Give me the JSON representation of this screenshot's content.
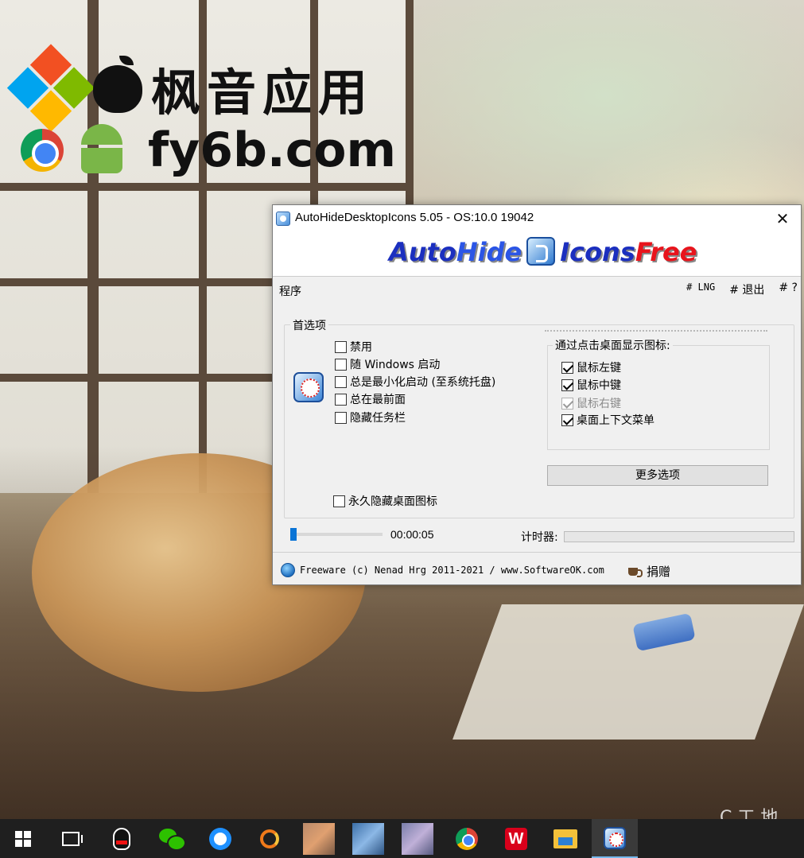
{
  "watermark": {
    "title": "枫音应用",
    "url": "fy6b.com"
  },
  "window": {
    "title": "AutoHideDesktopIcons 5.05 - OS:10.0 19042",
    "close": "✕"
  },
  "banner": {
    "auto": "Auto",
    "hide": "Hide",
    "icons": "Icons",
    "free": "Free"
  },
  "menu": {
    "program": "程序",
    "lng": "# LNG",
    "exit": "# 退出",
    "help": "# ?"
  },
  "preferences": {
    "label": "首选项",
    "options": [
      {
        "label": "禁用",
        "checked": false
      },
      {
        "label": "随 Windows 启动",
        "checked": false
      },
      {
        "label": "总是最小化启动 (至系统托盘)",
        "checked": false
      },
      {
        "label": "总在最前面",
        "checked": false
      },
      {
        "label": "隐藏任务栏",
        "checked": false
      }
    ],
    "permanent_hide": {
      "label": "永久隐藏桌面图标",
      "checked": false
    }
  },
  "show_icons": {
    "label": "通过点击桌面显示图标:",
    "options": [
      {
        "label": "鼠标左键",
        "checked": true,
        "disabled": false
      },
      {
        "label": "鼠标中键",
        "checked": true,
        "disabled": false
      },
      {
        "label": "鼠标右键",
        "checked": true,
        "disabled": true
      },
      {
        "label": "桌面上下文菜单",
        "checked": true,
        "disabled": false
      }
    ],
    "more_options": "更多选项"
  },
  "timer": {
    "delay": "00:00:05",
    "label": "计时器:"
  },
  "footer": {
    "copyright": "Freeware (c) Nenad Hrg 2011-2021 / www.SoftwareOK.com",
    "donate": "捐赠"
  },
  "desktop": {
    "corner_text": "C 工 地"
  },
  "taskbar": {
    "items": [
      "start-icon",
      "task-view-icon",
      "qq-icon",
      "wechat-icon",
      "qq-browser-icon",
      "g-app-icon",
      "blurred-app-1",
      "blurred-app-2",
      "blurred-app-3",
      "chrome-icon",
      "wps-icon",
      "file-explorer-icon",
      "autohide-icon"
    ]
  }
}
